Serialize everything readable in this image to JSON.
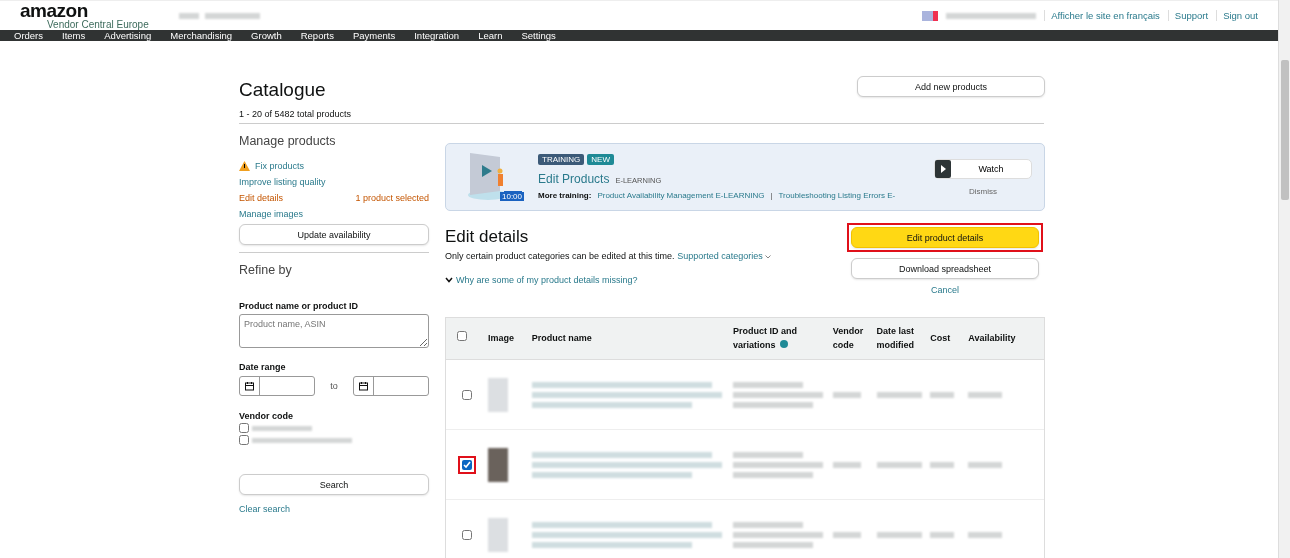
{
  "header": {
    "logo": "amazon",
    "logo_sub": "Vendor Central Europe",
    "links": [
      "Afficher le site en français",
      "Support",
      "Sign out"
    ]
  },
  "nav": [
    "Orders",
    "Items",
    "Advertising",
    "Merchandising",
    "Growth",
    "Reports",
    "Payments",
    "Integration",
    "Learn",
    "Settings"
  ],
  "page": {
    "title": "Catalogue",
    "count": "1 - 20 of 5482 total products",
    "add_button": "Add new products"
  },
  "manage": {
    "title": "Manage products",
    "items": [
      {
        "label": "Fix products",
        "kind": "warning"
      },
      {
        "label": "Improve listing quality",
        "kind": "link"
      },
      {
        "label": "Edit details",
        "kind": "active",
        "note": "1 product selected"
      },
      {
        "label": "Manage images",
        "kind": "link"
      }
    ],
    "button": "Update availability"
  },
  "refine": {
    "title": "Refine by",
    "name_label": "Product name or product ID",
    "name_placeholder": "Product name, ASIN",
    "date_label": "Date range",
    "date_sep": "to",
    "vendor_label": "Vendor code",
    "vendor_options": [
      {
        "checked": false
      },
      {
        "checked": false
      }
    ],
    "search_button": "Search",
    "clear": "Clear search"
  },
  "training": {
    "tags": [
      "TRAINING",
      "NEW"
    ],
    "title": "Edit Products",
    "type": "E-LEARNING",
    "duration": "10:00",
    "more_label": "More training:",
    "more_links": [
      "Product Availability Management E-LEARNING",
      "Troubleshooting Listing Errors E-"
    ],
    "separator": "|",
    "watch": "Watch",
    "dismiss": "Dismiss"
  },
  "edit": {
    "title": "Edit details",
    "note": "Only certain product categories can be edited at this time.",
    "note_link": "Supported categories",
    "why": "Why are some of my product details missing?",
    "primary": {
      "label": "Edit product details",
      "highlighted": true
    },
    "download": "Download spreadsheet",
    "cancel": "Cancel"
  },
  "table": {
    "select_all": {
      "checked": false
    },
    "columns": [
      "Image",
      "Product name",
      "Product ID and variations",
      "Vendor code",
      "Date last modified",
      "Cost",
      "Availability"
    ],
    "rows": [
      {
        "checked": false,
        "highlighted": false
      },
      {
        "checked": true,
        "highlighted": true
      },
      {
        "checked": false,
        "highlighted": false
      }
    ]
  }
}
